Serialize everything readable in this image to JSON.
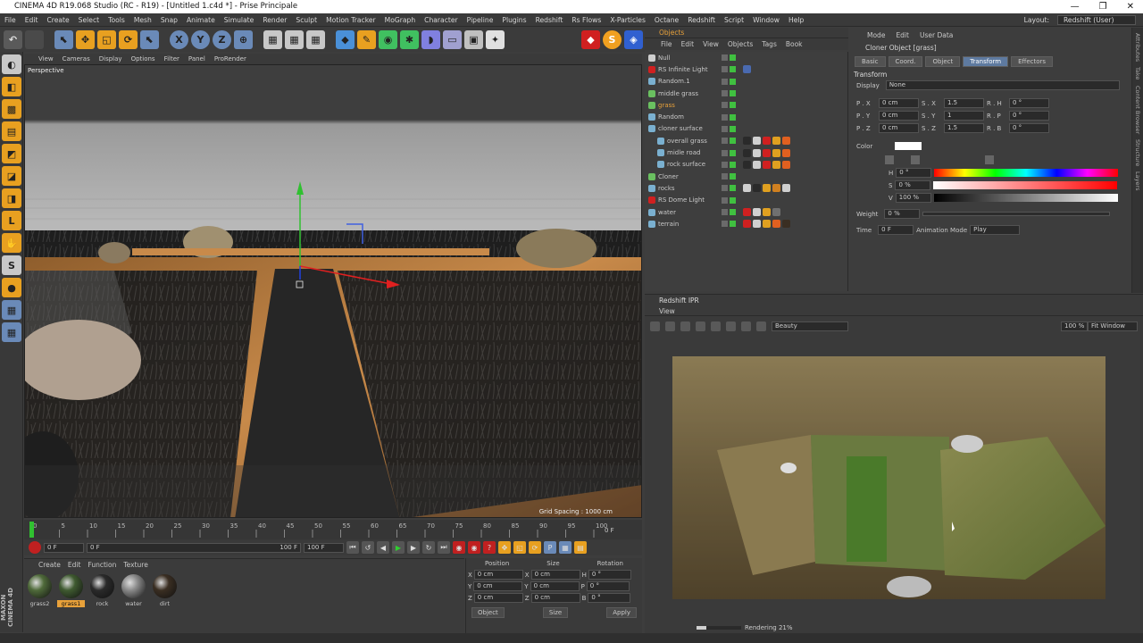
{
  "window": {
    "title": "CINEMA 4D R19.068 Studio (RC - R19) - [Untitled 1.c4d *] - Prise Principale"
  },
  "menu": [
    "File",
    "Edit",
    "Create",
    "Select",
    "Tools",
    "Mesh",
    "Snap",
    "Animate",
    "Simulate",
    "Render",
    "Sculpt",
    "Motion Tracker",
    "MoGraph",
    "Character",
    "Pipeline",
    "Plugins",
    "Redshift",
    "Rs Flows",
    "X-Particles",
    "Octane",
    "Redshift",
    "Script",
    "Window",
    "Help"
  ],
  "layout": {
    "label": "Layout:",
    "value": "Redshift (User)"
  },
  "viewport": {
    "menu": [
      "View",
      "Cameras",
      "Display",
      "Options",
      "Filter",
      "Panel",
      "ProRender"
    ],
    "camera": "Perspective",
    "grid_spacing": "Grid Spacing : 1000 cm"
  },
  "timeline": {
    "ticks": [
      "0",
      "5",
      "10",
      "15",
      "20",
      "25",
      "30",
      "35",
      "40",
      "45",
      "50",
      "55",
      "60",
      "65",
      "70",
      "75",
      "80",
      "85",
      "90",
      "95",
      "100"
    ],
    "end_frame": "0 F"
  },
  "transport": {
    "current": "0 F",
    "start": "0 F",
    "end_slider": "100 F",
    "end": "100 F"
  },
  "materials": {
    "menu": [
      "Create",
      "Edit",
      "Function",
      "Texture"
    ],
    "items": [
      {
        "name": "grass2",
        "color": "#4f6a3a"
      },
      {
        "name": "grass1",
        "color": "#3f5a30",
        "selected": true
      },
      {
        "name": "rock",
        "color": "#2a2a2a"
      },
      {
        "name": "water",
        "color": "#8a8a8a"
      },
      {
        "name": "dirt",
        "color": "#3a2e22"
      }
    ]
  },
  "coords": {
    "headers": [
      "Position",
      "Size",
      "Rotation"
    ],
    "rows": [
      {
        "a": "X",
        "pos": "0 cm",
        "b": "X",
        "size": "0 cm",
        "c": "H",
        "rot": "0 °"
      },
      {
        "a": "Y",
        "pos": "0 cm",
        "b": "Y",
        "size": "0 cm",
        "c": "P",
        "rot": "0 °"
      },
      {
        "a": "Z",
        "pos": "0 cm",
        "b": "Z",
        "size": "0 cm",
        "c": "B",
        "rot": "0 °"
      }
    ],
    "mode": "Object",
    "size_mode": "Size",
    "apply": "Apply"
  },
  "objects": {
    "title": "Objects",
    "menu": [
      "File",
      "Edit",
      "View",
      "Objects",
      "Tags",
      "Book"
    ],
    "rows": [
      {
        "name": "Null",
        "icon": "#cfcfcf",
        "indent": 0,
        "tags": []
      },
      {
        "name": "RS Infinite Light",
        "icon": "#d02020",
        "indent": 0,
        "tags": [
          "#4a6ab0"
        ]
      },
      {
        "name": "Random.1",
        "icon": "#7ab0d0",
        "indent": 0,
        "tags": []
      },
      {
        "name": "middle grass",
        "icon": "#6ac060",
        "indent": 0,
        "tags": []
      },
      {
        "name": "grass",
        "icon": "#6ac060",
        "indent": 0,
        "tags": [],
        "highlight": true
      },
      {
        "name": "Random",
        "icon": "#7ab0d0",
        "indent": 0,
        "tags": []
      },
      {
        "name": "cloner surface",
        "icon": "#7ab0d0",
        "indent": 0,
        "tags": []
      },
      {
        "name": "overall grass",
        "icon": "#7ab0d0",
        "indent": 1,
        "tags": [
          "#2a2a2a",
          "#d0d0d0",
          "#d02020",
          "#e0a020",
          "#e06020"
        ]
      },
      {
        "name": "midle road",
        "icon": "#7ab0d0",
        "indent": 1,
        "tags": [
          "#2a2a2a",
          "#d0d0d0",
          "#d02020",
          "#e0a020",
          "#e06020"
        ]
      },
      {
        "name": "rock surface",
        "icon": "#7ab0d0",
        "indent": 1,
        "tags": [
          "#2a2a2a",
          "#d0d0d0",
          "#d02020",
          "#e0a020",
          "#e06020"
        ]
      },
      {
        "name": "Cloner",
        "icon": "#6ac060",
        "indent": 0,
        "tags": []
      },
      {
        "name": "rocks",
        "icon": "#7ab0d0",
        "indent": 0,
        "tags": [
          "#d0d0d0",
          "#2a2a2a",
          "#e0a020",
          "#d08020",
          "#d0d0d0"
        ]
      },
      {
        "name": "RS Dome Light",
        "icon": "#d02020",
        "indent": 0,
        "tags": []
      },
      {
        "name": "water",
        "icon": "#7ab0d0",
        "indent": 0,
        "tags": [
          "#d02020",
          "#d0d0d0",
          "#e0a020",
          "#707070"
        ]
      },
      {
        "name": "terrain",
        "icon": "#7ab0d0",
        "indent": 0,
        "tags": [
          "#d02020",
          "#d0d0d0",
          "#e0a020",
          "#e06020",
          "#3a2e22"
        ]
      }
    ]
  },
  "attributes": {
    "menu": [
      "Mode",
      "Edit",
      "User Data"
    ],
    "title": "Cloner Object [grass]",
    "tabs": [
      "Basic",
      "Coord.",
      "Object",
      "Transform",
      "Effectors"
    ],
    "active_tab": "Transform",
    "section": "Transform",
    "display_label": "Display",
    "display_value": "None",
    "rows": [
      {
        "l1": "P . X",
        "v1": "0 cm",
        "l2": "S . X",
        "v2": "1.5",
        "l3": "R . H",
        "v3": "0 °"
      },
      {
        "l1": "P . Y",
        "v1": "0 cm",
        "l2": "S . Y",
        "v2": "1",
        "l3": "R . P",
        "v3": "0 °"
      },
      {
        "l1": "P . Z",
        "v1": "0 cm",
        "l2": "S . Z",
        "v2": "1.5",
        "l3": "R . B",
        "v3": "0 °"
      }
    ],
    "color_label": "Color",
    "h_label": "H",
    "h_value": "0 °",
    "s_label": "S",
    "s_value": "0 %",
    "v_label": "V",
    "v_value": "100 %",
    "weight_label": "Weight",
    "weight_value": "0 %",
    "time_label": "Time",
    "time_value": "0 F",
    "anim_label": "Animation Mode",
    "anim_value": "Play"
  },
  "side_tabs": [
    "Attributes",
    "Take",
    "Content Browser",
    "Structure",
    "Layers"
  ],
  "ipr": {
    "title": "Redshift IPR",
    "sub": "View",
    "pass": "Beauty",
    "zoom": "100 %",
    "fit": "Fit Window",
    "status": "Rendering 21%",
    "progress": 0.21
  },
  "colors": {
    "accent": "#5e7aa0",
    "highlight": "#e8a13a"
  }
}
